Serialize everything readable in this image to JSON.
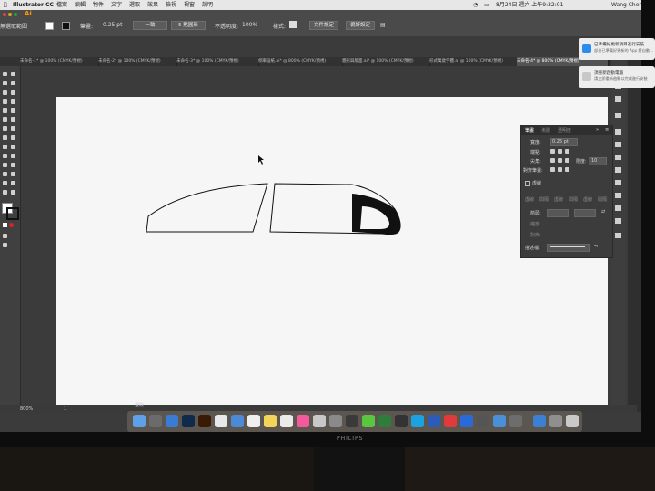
{
  "menubar": {
    "apple": "",
    "app_name": "Illustrator CC",
    "items": [
      "檔案",
      "編輯",
      "物件",
      "文字",
      "選取",
      "效果",
      "檢視",
      "視窗",
      "說明"
    ],
    "clock": "8月24日 週六 上午9:32:01",
    "user": "Wang Chen"
  },
  "control_bar": {
    "app_logo": "Ai",
    "no_selection": "無選取範圍",
    "stroke_label": "筆畫:",
    "stroke_value": "0.25 pt",
    "uniform": "一致",
    "point_round": "5 點圓形",
    "opacity_label": "不透明度:",
    "opacity_value": "100%",
    "style_label": "樣式:",
    "doc_setup": "文件設定",
    "preferences": "偏好設定"
  },
  "tabs": [
    {
      "label": "未命名-1* @ 100% (CMYK/預視)",
      "active": false
    },
    {
      "label": "未命名-2* @ 100% (CMYK/預視)",
      "active": false
    },
    {
      "label": "未命名-3* @ 100% (CMYK/預視)",
      "active": false
    },
    {
      "label": "側車設紙.ai* @ 800% (CMYK/預視)",
      "active": false
    },
    {
      "label": "圖形與版面.ai* @ 100% (CMYK/預視)",
      "active": false
    },
    {
      "label": "形式萬歲字體.ai @ 100% (CMYK/預視)",
      "active": false
    },
    {
      "label": "未命名-4* @ 800% (CMYK/預視)",
      "active": true
    }
  ],
  "stroke_panel": {
    "tabs": [
      "筆畫",
      "漸層",
      "透明度"
    ],
    "weight_label": "寬度:",
    "weight_value": "0.25 pt",
    "cap_label": "端點:",
    "corner_label": "尖角:",
    "limit_label": "限度:",
    "limit_value": "10",
    "align_label": "對齊筆畫:",
    "dashed_label": "虛線",
    "dash_labels": [
      "虛線",
      "間隔",
      "虛線",
      "間隔",
      "虛線",
      "間隔"
    ],
    "arrow_label": "箭頭:",
    "scale_label": "縮放:",
    "align2_label": "對齊:",
    "profile_label": "描述檔:"
  },
  "notifications": [
    {
      "title": "已準備好更新項目進行安裝",
      "subtitle": "部分已準備好更新的 App 將自動..."
    },
    {
      "title": "須重新啟動電腦",
      "subtitle": "請立即重新啟動以完成進行安裝"
    }
  ],
  "status": {
    "zoom": "800%",
    "page": "1",
    "mode": "選取"
  },
  "monitor_brand": "PHILIPS",
  "colors": {
    "ui_dark": "#3b3b3b",
    "artboard": "#f6f6f6",
    "shape_stroke": "#111111"
  }
}
